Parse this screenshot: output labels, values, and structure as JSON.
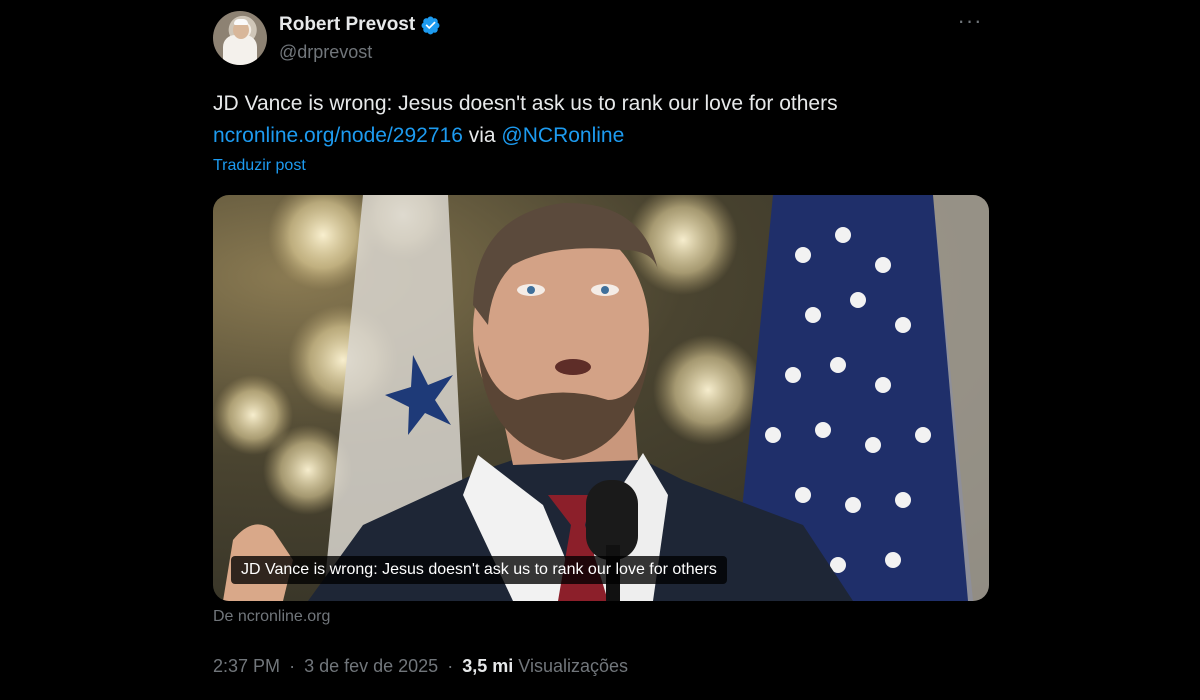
{
  "author": {
    "name": "Robert Prevost",
    "handle": "@drprevost",
    "verified_icon": "verified-badge-icon",
    "avatar_icon": "avatar-image"
  },
  "post": {
    "text": "JD Vance is wrong: Jesus doesn't ask us to rank our love for others",
    "link_text": "ncronline.org/node/292716",
    "via_text": "via",
    "mention_text": "@NCRonline",
    "translate_label": "Traduzir post"
  },
  "card": {
    "caption": "JD Vance is wrong: Jesus doesn't ask us to rank our love for others",
    "source": "De ncronline.org"
  },
  "meta": {
    "time": "2:37 PM",
    "separator": "·",
    "date": "3 de fev de 2025",
    "views_count": "3,5 mi",
    "views_label": "Visualizações"
  },
  "more_label": "···",
  "colors": {
    "background": "#000000",
    "primary_text": "#e7e9ea",
    "secondary_text": "#71767b",
    "link": "#1d9bf0",
    "verified": "#1d9bf0"
  }
}
